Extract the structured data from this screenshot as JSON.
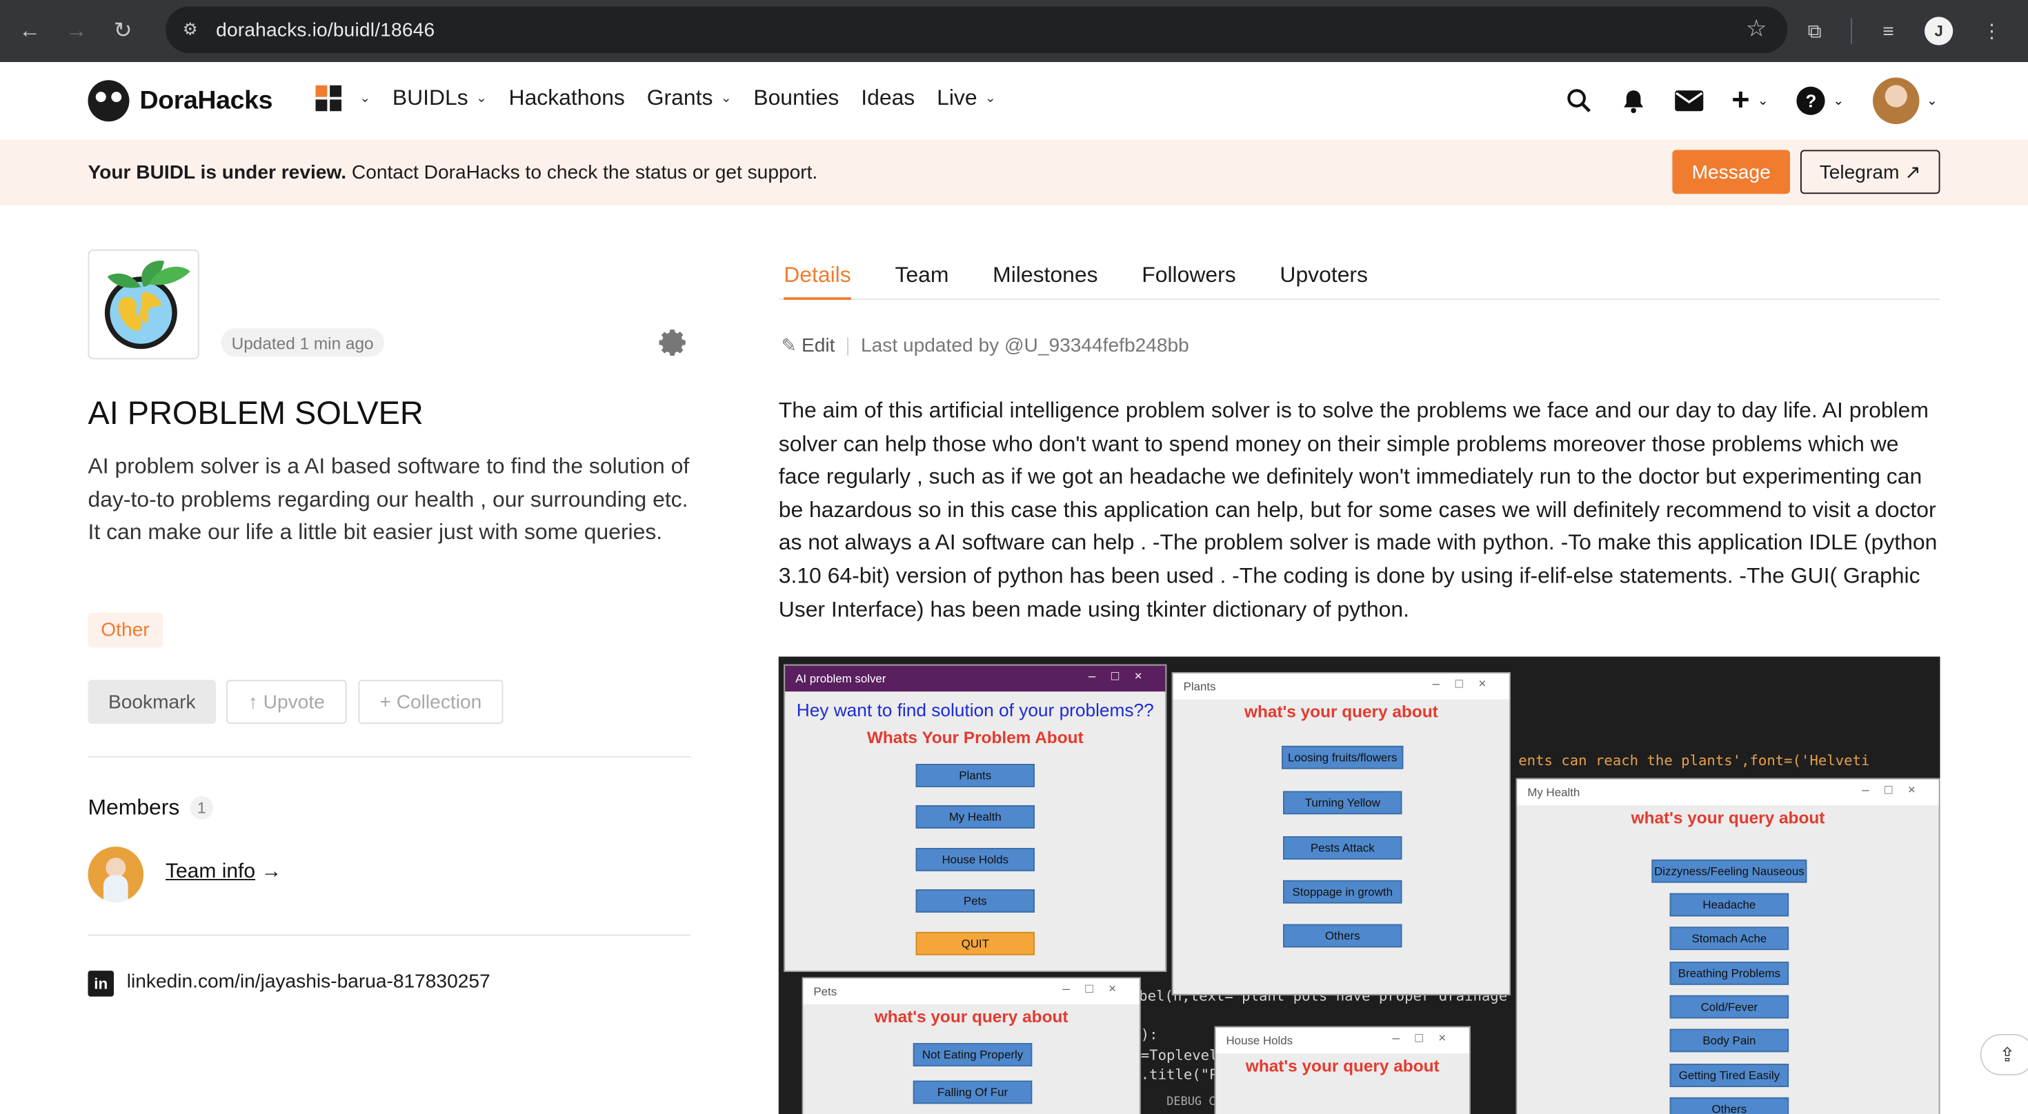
{
  "browser": {
    "url": "dorahacks.io/buidl/18646",
    "profile_initial": "J"
  },
  "nav": {
    "brand": "DoraHacks",
    "items": [
      "BUIDLs",
      "Hackathons",
      "Grants",
      "Bounties",
      "Ideas",
      "Live"
    ]
  },
  "banner": {
    "bold": "Your BUIDL is under review.",
    "text": " Contact DoraHacks to check the status or get support.",
    "message_btn": "Message",
    "telegram_btn": "Telegram ↗"
  },
  "project": {
    "updated": "Updated 1 min ago",
    "title": "AI PROBLEM SOLVER",
    "description": "AI problem solver is a AI based software to find the solution of day-to-to problems regarding our health , our surrounding etc. It can make our life a little bit easier just with some queries.",
    "tag": "Other",
    "bookmark": "Bookmark",
    "upvote": "↑ Upvote",
    "collection": "+ Collection",
    "members_label": "Members",
    "members_count": "1",
    "team_info": "Team info",
    "team_info_arrow": "→",
    "linkedin": "linkedin.com/in/jayashis-barua-817830257"
  },
  "tabs": [
    "Details",
    "Team",
    "Milestones",
    "Followers",
    "Upvoters"
  ],
  "details": {
    "edit": "Edit",
    "last_updated": "Last updated by @U_93344fefb248bb",
    "body": "The aim of this artificial intelligence problem solver is to solve the problems we face and our day to day life. AI problem solver can help those who don't want to spend money on their simple problems moreover those problems which we face regularly , such as if we got an headache we definitely won't immediately run to the doctor but experimenting can be hazardous so in this case this application can help, but for some cases we will definitely recommend to visit a doctor as not always a AI software can help . -The problem solver is made with python. -To make this application IDLE (python 3.10 64-bit) version of python has been used . -The coding is done by using if-elif-else statements. -The GUI( Graphic User Interface) has been made using tkinter dictionary of python."
  },
  "screenshot": {
    "main": {
      "title": "AI problem solver",
      "heading": "Hey want to find solution of your problems??",
      "sub": "Whats Your Problem About",
      "buttons": [
        "Plants",
        "My Health",
        "House Holds",
        "Pets",
        "QUIT"
      ]
    },
    "plants": {
      "title": "Plants",
      "heading": "what's your query about",
      "buttons": [
        "Loosing fruits/flowers",
        "Turning Yellow",
        "Pests Attack",
        "Stoppage in growth",
        "Others"
      ]
    },
    "health": {
      "title": "My Health",
      "heading": "what's your query about",
      "buttons": [
        "Dizzyness/Feeling Nauseous",
        "Headache",
        "Stomach Ache",
        "Breathing Problems",
        "Cold/Fever",
        "Body Pain",
        "Getting Tired Easily",
        "Others"
      ]
    },
    "pets": {
      "title": "Pets",
      "heading": "what's your query about",
      "buttons": [
        "Not Eating Properly",
        "Falling Of Fur"
      ]
    },
    "households": {
      "title": "House Holds",
      "heading": "what's your query about"
    },
    "code": "ents can reach the plants',font=('Helveti",
    "code2": "abel(h,text='plant pots have proper drainage s",
    "code3": "):",
    "code4": "=Toplevel",
    "code5": ".title(\"Po",
    "debug": "DEBUG C"
  },
  "colors": {
    "accent": "#f07c2f",
    "banner_bg": "#fdf1ec"
  }
}
